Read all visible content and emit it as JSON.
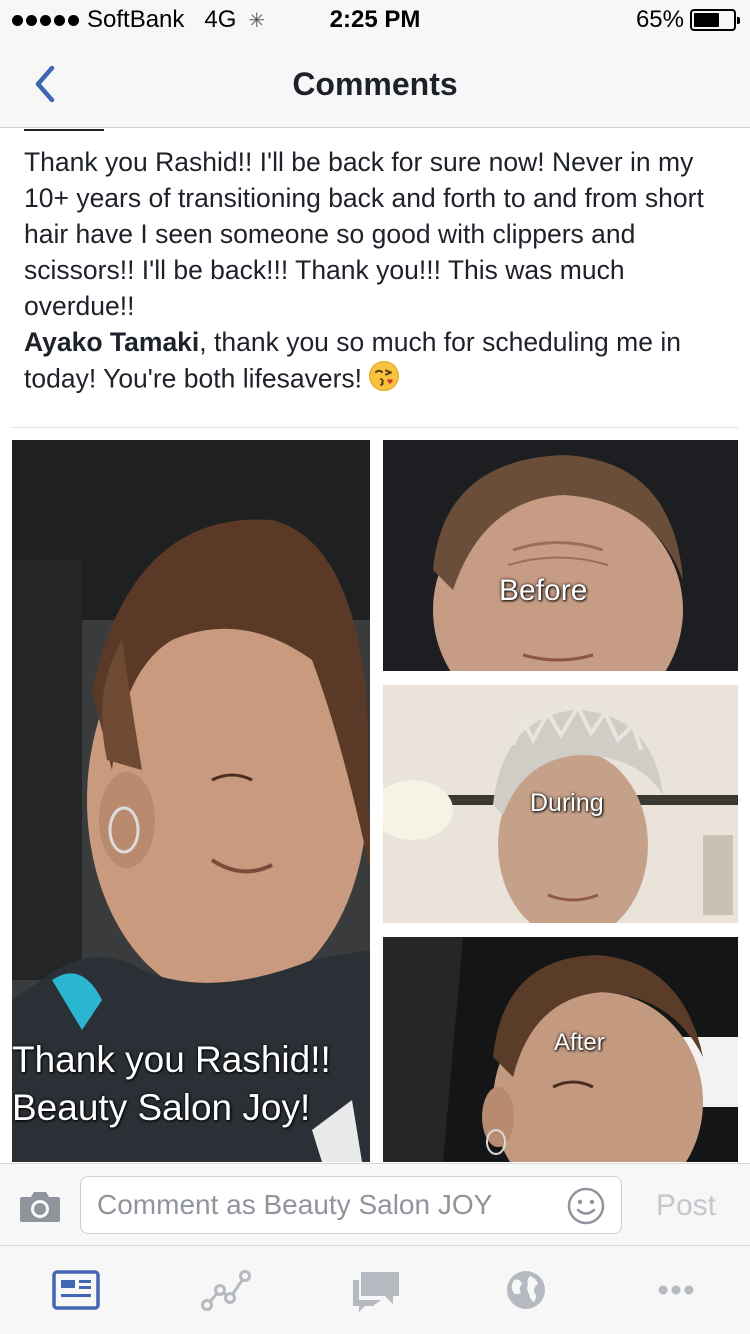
{
  "status_bar": {
    "carrier": "SoftBank",
    "network": "4G",
    "time": "2:25 PM",
    "battery_percent": "65%",
    "battery_level": 0.65,
    "signal_bars": 5
  },
  "nav": {
    "title": "Comments",
    "back_icon": "chevron-left-icon"
  },
  "comment": {
    "text_1": "Thank you Rashid!! I'll be back for sure now! Never in my 10+ years of transitioning back and forth to and from short hair have I seen someone so good with clippers and scissors!! I'll be back!!! Thank you!!! This was much overdue!!",
    "mention": "Ayako Tamaki",
    "text_2": ", thank you so much for scheduling me in today! You're both lifesavers!",
    "emoji": "face-blowing-kiss"
  },
  "photos": {
    "main_caption_1": "Thank you Rashid!!",
    "main_caption_2": "Beauty Salon Joy!",
    "before_caption": "Before",
    "during_caption": "During",
    "after_caption": "After"
  },
  "composer": {
    "placeholder": "Comment as Beauty Salon JOY",
    "post_label": "Post",
    "camera_icon": "camera-icon",
    "emoji_icon": "smiley-icon"
  },
  "tab_bar": {
    "items": [
      {
        "icon": "news-feed-icon",
        "active": true
      },
      {
        "icon": "activity-graph-icon",
        "active": false
      },
      {
        "icon": "messages-icon",
        "active": false
      },
      {
        "icon": "globe-icon",
        "active": false
      },
      {
        "icon": "more-icon",
        "active": false
      }
    ]
  },
  "colors": {
    "accent": "#4267b2",
    "tab_inactive": "#b5b9c0",
    "post_disabled": "#c4c7cc"
  }
}
